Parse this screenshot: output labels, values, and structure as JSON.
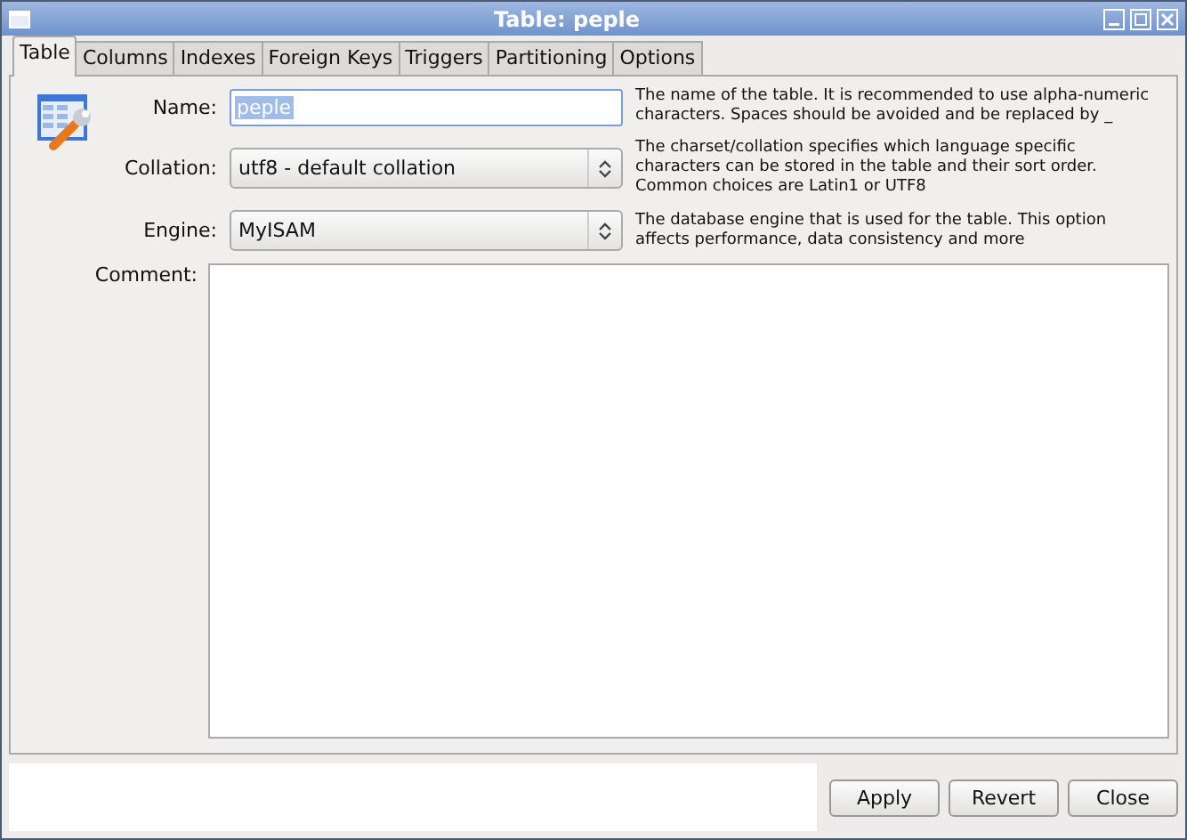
{
  "window": {
    "title": "Table: peple"
  },
  "tabs": [
    {
      "label": "Table",
      "selected": true
    },
    {
      "label": "Columns",
      "selected": false
    },
    {
      "label": "Indexes",
      "selected": false
    },
    {
      "label": "Foreign Keys",
      "selected": false
    },
    {
      "label": "Triggers",
      "selected": false
    },
    {
      "label": "Partitioning",
      "selected": false
    },
    {
      "label": "Options",
      "selected": false
    }
  ],
  "form": [
    {
      "kind": "text",
      "label": "Name:",
      "value": "peple",
      "help": "The name of the table. It is recommended to use alpha-numeric characters. Spaces should be avoided and be replaced by _"
    },
    {
      "kind": "select",
      "label": "Collation:",
      "value": "utf8 - default collation",
      "help": "The charset/collation specifies which language specific characters can be stored  in the table and their sort order. Common choices are Latin1 or UTF8"
    },
    {
      "kind": "select",
      "label": "Engine:",
      "value": "MyISAM",
      "help": "The database engine that is used for the table. This option affects performance, data consistency and more"
    }
  ],
  "comment": {
    "label": "Comment:"
  },
  "buttons": [
    "Apply",
    "Revert",
    "Close"
  ]
}
